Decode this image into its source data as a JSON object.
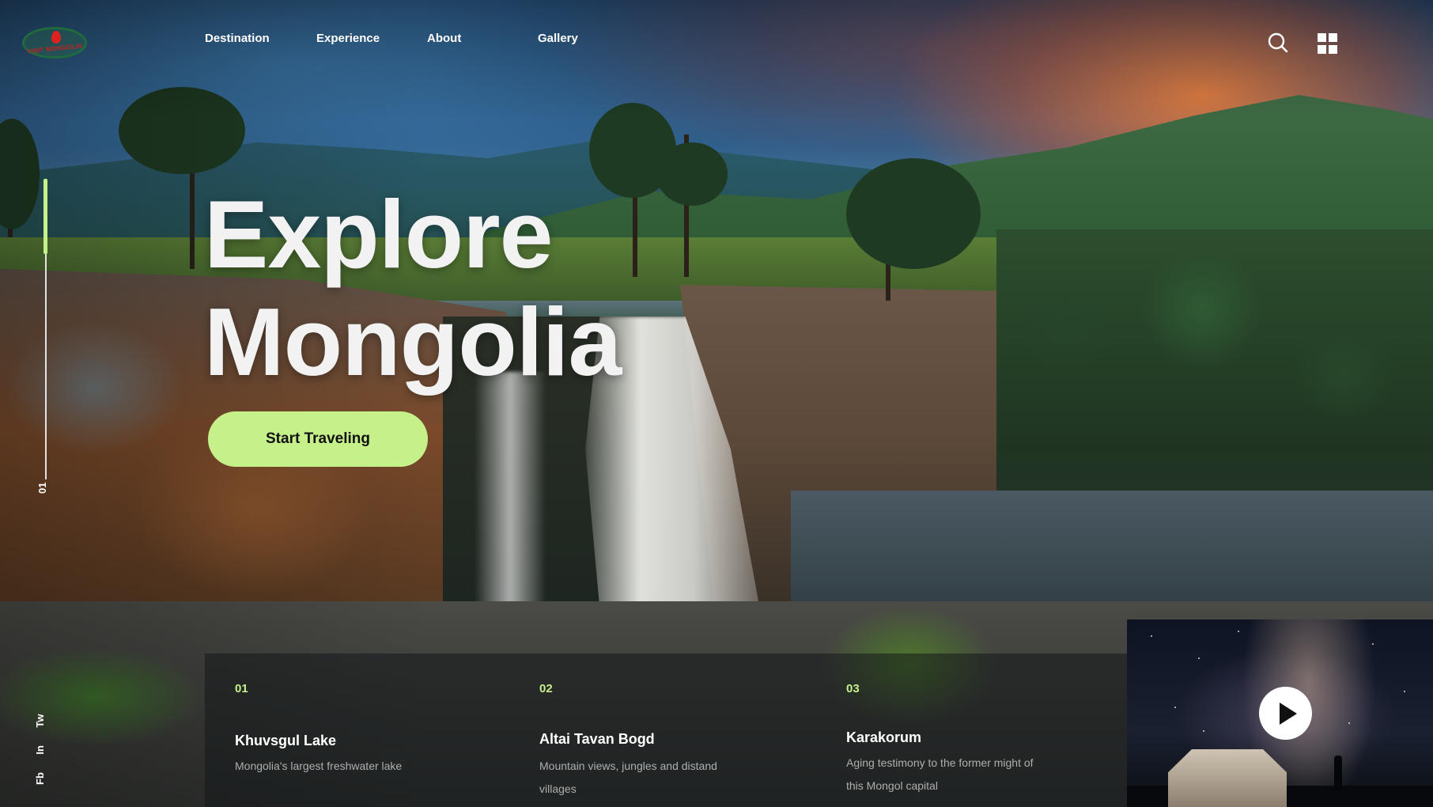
{
  "brand": {
    "logo_text": "VISIT MONGOLIA"
  },
  "nav": {
    "items": [
      {
        "label": "Destination"
      },
      {
        "label": "Experience"
      },
      {
        "label": "About"
      },
      {
        "label": "Gallery"
      }
    ]
  },
  "header": {
    "search_icon": "search-icon",
    "menu_icon": "grid-menu-icon"
  },
  "slider": {
    "current": "01"
  },
  "socials": {
    "items": [
      "Fb",
      "In",
      "Tw"
    ]
  },
  "hero": {
    "title_line1": "Explore",
    "title_line2": "Mongolia",
    "cta_label": "Start Traveling"
  },
  "destinations": [
    {
      "num": "01",
      "title": "Khuvsgul Lake",
      "desc": "Mongolia's largest freshwater lake"
    },
    {
      "num": "02",
      "title": "Altai Tavan Bogd",
      "desc": "Mountain views, jungles and distand villages"
    },
    {
      "num": "03",
      "title": "Karakorum",
      "desc": "Aging testimony to the former might of this Mongol capital"
    }
  ],
  "video": {
    "play_icon": "play-icon"
  },
  "colors": {
    "accent": "#c6f08a",
    "card_bg": "rgba(20,24,26,0.55)"
  }
}
